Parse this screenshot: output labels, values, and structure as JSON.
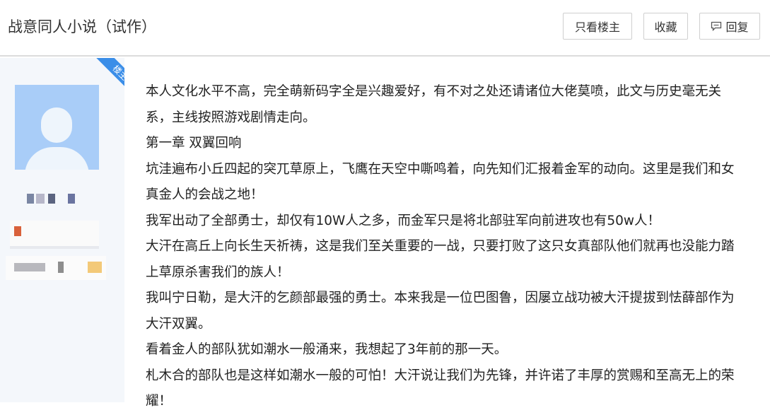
{
  "header": {
    "title": "战意同人小说（试作）",
    "buttons": {
      "only_op": "只看楼主",
      "favorite": "收藏",
      "reply": "回复"
    }
  },
  "sidebar": {
    "badge": "楼主"
  },
  "post": {
    "paragraphs": [
      "本人文化水平不高，完全萌新码字全是兴趣爱好，有不对之处还请诸位大佬莫喷，此文与历史毫无关系，主线按照游戏剧情走向。",
      "第一章 双翼回响",
      "坑洼遍布小丘四起的突兀草原上，飞鹰在天空中嘶鸣着，向先知们汇报着金军的动向。这里是我们和女真金人的会战之地！",
      "我军出动了全部勇士，却仅有10W人之多，而金军只是将北部驻军向前进攻也有50w人！",
      "大汗在高丘上向长生天祈祷，这是我们至关重要的一战，只要打败了这只女真部队他们就再也没能力踏上草原杀害我们的族人！",
      "我叫宁日勒，是大汗的乞颜部最强的勇士。本来我是一位巴图鲁，因屡立战功被大汗提拔到怯薛部作为大汗双翼。",
      "看着金人的部队犹如潮水一般涌来，我想起了3年前的那一天。",
      "札木合的部队也是这样如潮水一般的可怕！大汗说让我们为先锋，并许诺了丰厚的赏赐和至高无上的荣耀！"
    ]
  },
  "colors": {
    "badge": "#3b8ee8",
    "avatar_bg": "#a9cdf8",
    "sidebar_bg": "#f4f7fb"
  }
}
